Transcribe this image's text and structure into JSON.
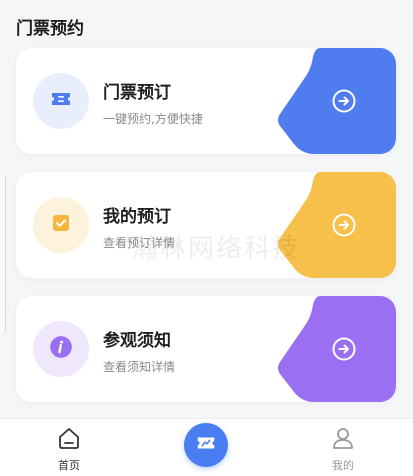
{
  "header": {
    "title": "门票预约"
  },
  "cards": [
    {
      "title": "门票预订",
      "subtitle": "一键预约,方便快捷",
      "accent": "#4f7df0",
      "badge_bg": "#e8eefc",
      "icon": "ticket-icon"
    },
    {
      "title": "我的预订",
      "subtitle": "查看预订详情",
      "accent": "#f6c04a",
      "badge_bg": "#fdf2dc",
      "icon": "checkbox-icon"
    },
    {
      "title": "参观须知",
      "subtitle": "查看须知详情",
      "accent": "#9a6ff2",
      "badge_bg": "#efe8fc",
      "icon": "info-icon"
    }
  ],
  "watermark": {
    "text": "瀚林网络科技"
  },
  "tabbar": {
    "home_label": "首页",
    "mine_label": "我的",
    "active_color": "#333333",
    "inactive_color": "#9a9a9a",
    "center_icon": "ticket-icon"
  }
}
